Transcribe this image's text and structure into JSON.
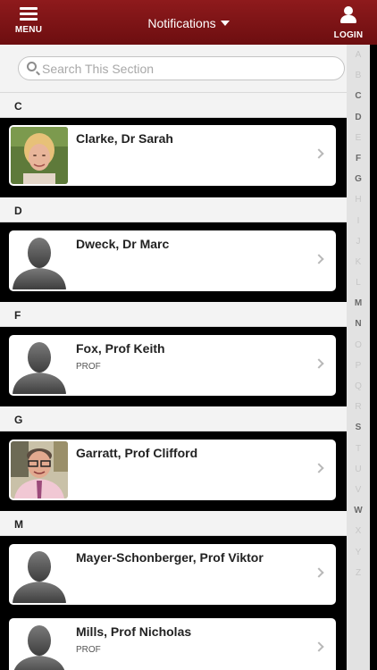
{
  "header": {
    "menu_label": "MENU",
    "title": "Notifications",
    "login_label": "LOGIN"
  },
  "search": {
    "placeholder": "Search This Section"
  },
  "sections": [
    {
      "letter": "C",
      "people": [
        {
          "name": "Clarke, Dr Sarah",
          "subtitle": "",
          "photo": "photo-sarah"
        }
      ]
    },
    {
      "letter": "D",
      "people": [
        {
          "name": "Dweck, Dr Marc",
          "subtitle": "",
          "photo": "silhouette"
        }
      ]
    },
    {
      "letter": "F",
      "people": [
        {
          "name": "Fox, Prof Keith",
          "subtitle": "PROF",
          "photo": "silhouette"
        }
      ]
    },
    {
      "letter": "G",
      "people": [
        {
          "name": "Garratt, Prof Clifford",
          "subtitle": "",
          "photo": "photo-clifford"
        }
      ]
    },
    {
      "letter": "M",
      "people": [
        {
          "name": "Mayer-Schonberger, Prof Viktor",
          "subtitle": "",
          "photo": "silhouette"
        },
        {
          "name": "Mills, Prof Nicholas",
          "subtitle": "PROF",
          "photo": "silhouette"
        }
      ]
    }
  ],
  "index_letters": [
    "A",
    "B",
    "C",
    "D",
    "E",
    "F",
    "G",
    "H",
    "I",
    "J",
    "K",
    "L",
    "M",
    "N",
    "O",
    "P",
    "Q",
    "R",
    "S",
    "T",
    "U",
    "V",
    "W",
    "X",
    "Y",
    "Z"
  ],
  "index_active": [
    "C",
    "D",
    "F",
    "G",
    "M",
    "N",
    "S",
    "W"
  ],
  "colors": {
    "header_bg": "#7d1416",
    "text": "#222222"
  }
}
